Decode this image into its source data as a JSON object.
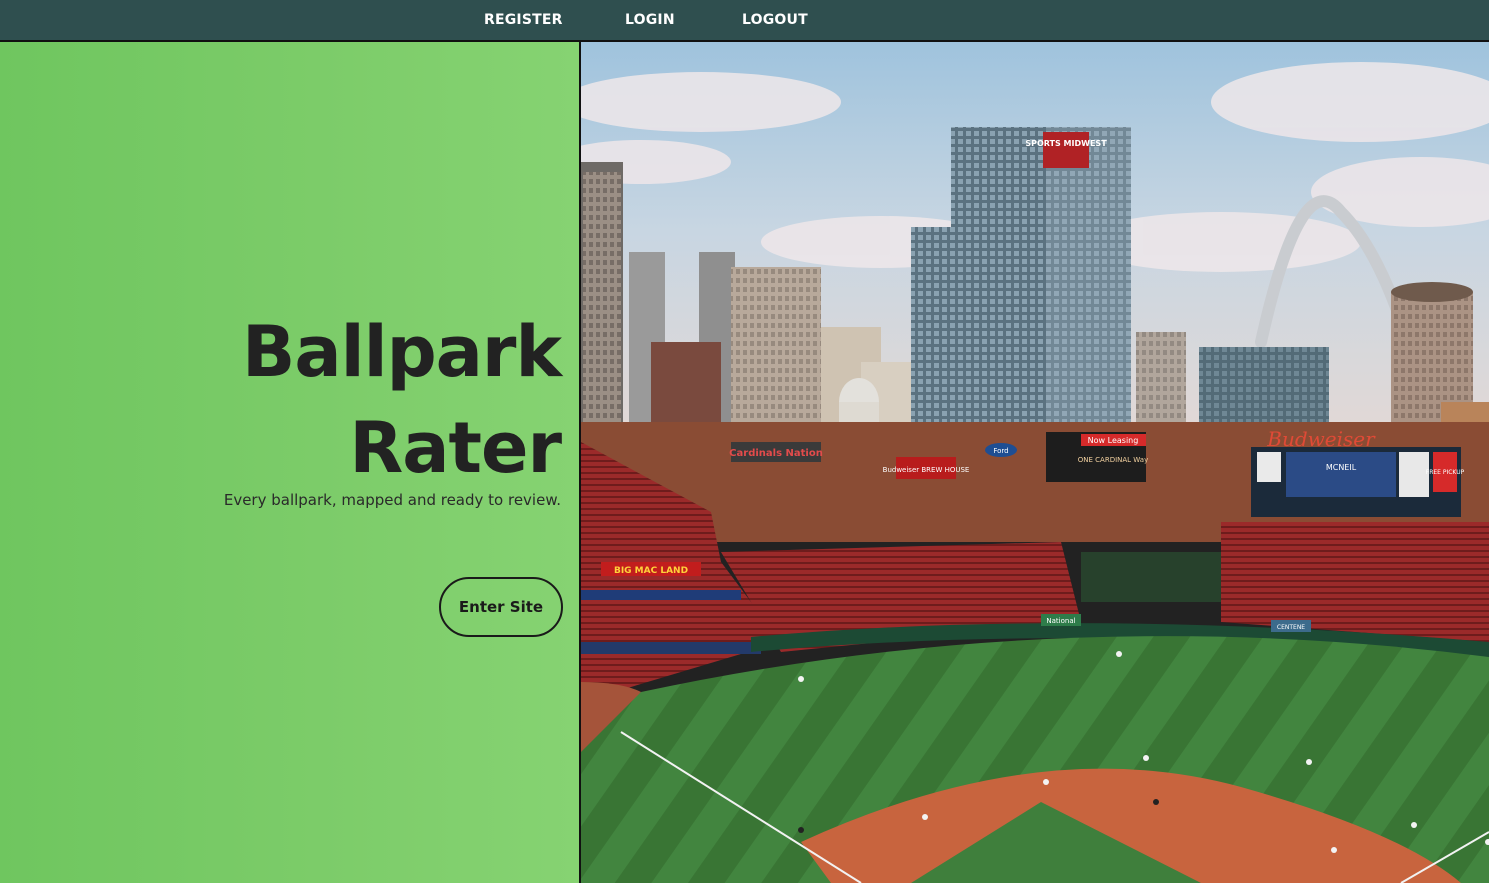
{
  "nav": {
    "register": "REGISTER",
    "login": "LOGIN",
    "logout": "LOGOUT"
  },
  "hero": {
    "title_line1": "Ballpark",
    "title_line2": "Rater",
    "subtitle": "Every ballpark, mapped and ready to review.",
    "cta": "Enter Site"
  },
  "photo": {
    "subject": "stadium-skyline-photo",
    "signs": {
      "sports_tower": "SPORTS MIDWEST",
      "budweiser": "Budweiser",
      "now_leasing": "Now Leasing",
      "one_cardinal": "ONE CARDINAL Way",
      "big_mac_land": "BIG MAC LAND",
      "scoreboard_name": "MCNEIL",
      "ford": "Ford",
      "brew_house": "Budweiser BREW HOUSE",
      "free_pickup": "FREE PICKUP",
      "national": "National",
      "centene": "CENTENE"
    }
  },
  "colors": {
    "nav_bg": "#2f4f4f",
    "hero_green": "#7ccc69",
    "title_text": "#222222",
    "field_green": "#3f7a3a",
    "dirt": "#c8643e"
  }
}
